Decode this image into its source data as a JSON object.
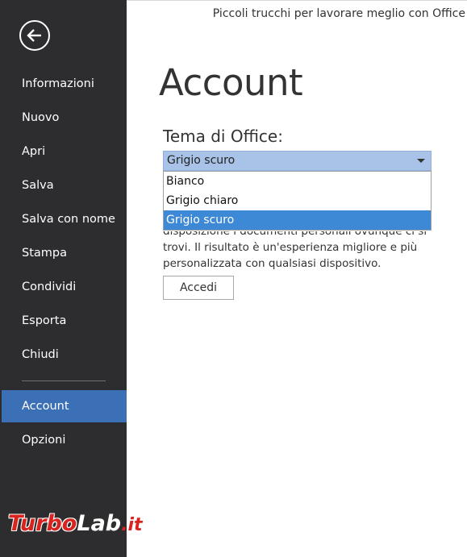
{
  "window": {
    "title": "Piccoli trucchi per lavorare meglio con Office"
  },
  "sidebar": {
    "back_icon": "arrow-left-circle-icon",
    "items": [
      {
        "label": "Informazioni"
      },
      {
        "label": "Nuovo"
      },
      {
        "label": "Apri"
      },
      {
        "label": "Salva"
      },
      {
        "label": "Salva con nome"
      },
      {
        "label": "Stampa"
      },
      {
        "label": "Condividi"
      },
      {
        "label": "Esporta"
      },
      {
        "label": "Chiudi"
      },
      {
        "label": "Account",
        "active": true
      },
      {
        "label": "Opzioni"
      }
    ]
  },
  "main": {
    "page_title": "Account",
    "theme": {
      "label": "Tema di Office:",
      "selected": "Grigio scuro",
      "options": [
        "Bianco",
        "Grigio chiaro",
        "Grigio scuro"
      ]
    },
    "body_lines": [
      "disposizione i documenti personali ovunque ci si",
      "trovi. Il risultato è un'esperienza migliore e più",
      "personalizzata con qualsiasi dispositivo."
    ],
    "signin_label": "Accedi"
  },
  "watermark": {
    "part1": "Turbo",
    "part2": "Lab",
    "part3": ".it"
  },
  "colors": {
    "sidebar_bg": "#2d2d30",
    "active_item": "#3b6fb6",
    "select_bg": "#a9c3e8",
    "option_highlight": "#3e89d6"
  }
}
